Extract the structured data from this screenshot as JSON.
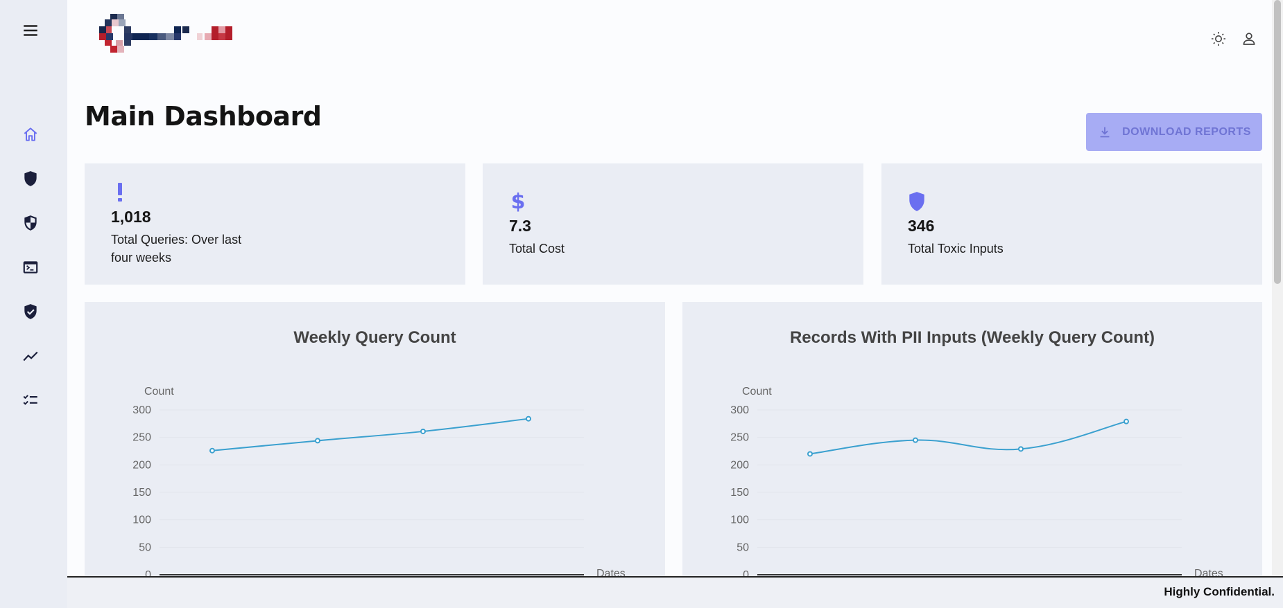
{
  "header": {
    "menu_icon": "menu-icon",
    "theme_icon": "sun-icon",
    "account_icon": "account-icon"
  },
  "sidebar": {
    "items": [
      {
        "icon": "home-icon",
        "active": true
      },
      {
        "icon": "shield-icon"
      },
      {
        "icon": "shield-half-icon"
      },
      {
        "icon": "terminal-icon"
      },
      {
        "icon": "shield-check-icon"
      },
      {
        "icon": "trending-icon"
      },
      {
        "icon": "checklist-icon"
      }
    ]
  },
  "page": {
    "title": "Main Dashboard",
    "download_label": "DOWNLOAD REPORTS"
  },
  "stats": [
    {
      "icon": "exclamation-icon",
      "value": "1,018",
      "label": "Total Queries: Over last four weeks"
    },
    {
      "icon": "dollar-icon",
      "value": "7.3",
      "label": "Total Cost"
    },
    {
      "icon": "shield-icon",
      "value": "346",
      "label": "Total Toxic Inputs"
    }
  ],
  "colors": {
    "accent": "#6a6ff0",
    "line": "#3aa0cf",
    "button_bg": "#a7acf4"
  },
  "chart_data": [
    {
      "type": "line",
      "title": "Weekly Query Count",
      "ylabel": "Count",
      "xlabel": "Dates",
      "ylim": [
        0,
        300
      ],
      "yticks": [
        0,
        50,
        100,
        150,
        200,
        250,
        300
      ],
      "series": [
        {
          "values": [
            226,
            244,
            261,
            284
          ]
        }
      ]
    },
    {
      "type": "line",
      "title": "Records With PII Inputs (Weekly Query Count)",
      "ylabel": "Count",
      "xlabel": "Dates",
      "ylim": [
        0,
        300
      ],
      "yticks": [
        0,
        50,
        100,
        150,
        200,
        250,
        300
      ],
      "series": [
        {
          "values": [
            220,
            245,
            229,
            279
          ]
        }
      ]
    }
  ],
  "footer": {
    "text": "Highly Confidential."
  }
}
